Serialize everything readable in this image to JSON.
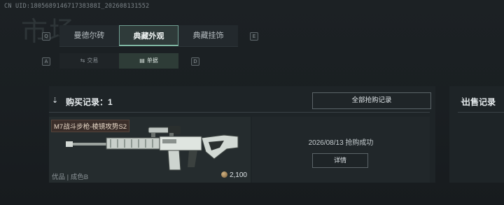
{
  "uid": "CN UID:180568914671738388I_202608131552",
  "bg_title": "市场",
  "tabs": {
    "key_left": "Q",
    "key_right": "E",
    "items": [
      {
        "label": "曼德尔砖"
      },
      {
        "label": "典藏外观"
      },
      {
        "label": "典藏挂饰"
      }
    ]
  },
  "subtabs": {
    "key_left": "A",
    "key_right": "D",
    "items": [
      {
        "label": "交易",
        "icon": "trade-icon"
      },
      {
        "label": "单据",
        "icon": "document-icon"
      }
    ]
  },
  "purchase": {
    "title": "购买记录：1",
    "all_button": "全部抢购记录",
    "item": {
      "name": "M7战斗步枪-棱镜攻势S2",
      "quality": "优品 | 成色B",
      "price": "2,100",
      "date_status": "2026/08/13 抢购成功",
      "detail_button": "详情"
    }
  },
  "sell": {
    "title": "出售记录"
  },
  "colors": {
    "accent": "#7fb8a3",
    "panel": "#1e2427",
    "item_tag": "#3a2e2a"
  }
}
